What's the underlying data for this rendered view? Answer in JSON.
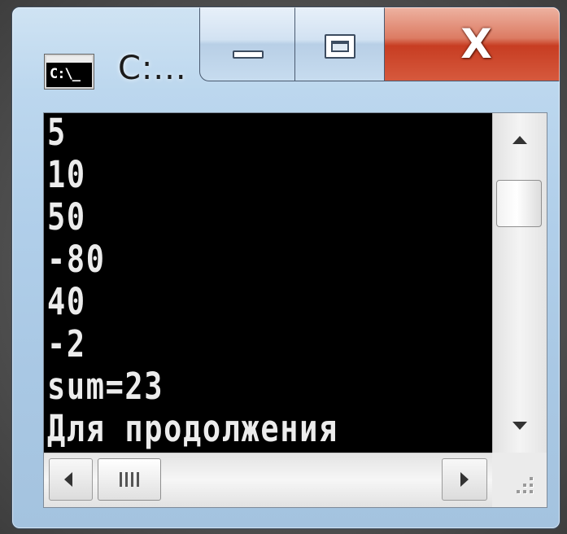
{
  "window": {
    "title": "C:..."
  },
  "title_icon": {
    "text": "C:\\_"
  },
  "caption_buttons": {
    "minimize_icon": "minimize-icon",
    "maximize_icon": "maximize-icon",
    "close_icon": "close-icon",
    "close_glyph": "X"
  },
  "console": {
    "lines": [
      "5",
      "10",
      "50",
      "-80",
      "40",
      "-2",
      "sum=23",
      "Для продолжения"
    ]
  },
  "scrollbars": {
    "vertical": {
      "up_icon": "triangle-up-icon",
      "down_icon": "triangle-down-icon"
    },
    "horizontal": {
      "left_icon": "triangle-left-icon",
      "right_icon": "triangle-right-icon",
      "grip_icon": "grip-lines-icon"
    }
  },
  "colors": {
    "console_bg": "#000000",
    "console_text": "#ececec",
    "close_button": "#c73d22",
    "frame": "#b1cfea"
  }
}
